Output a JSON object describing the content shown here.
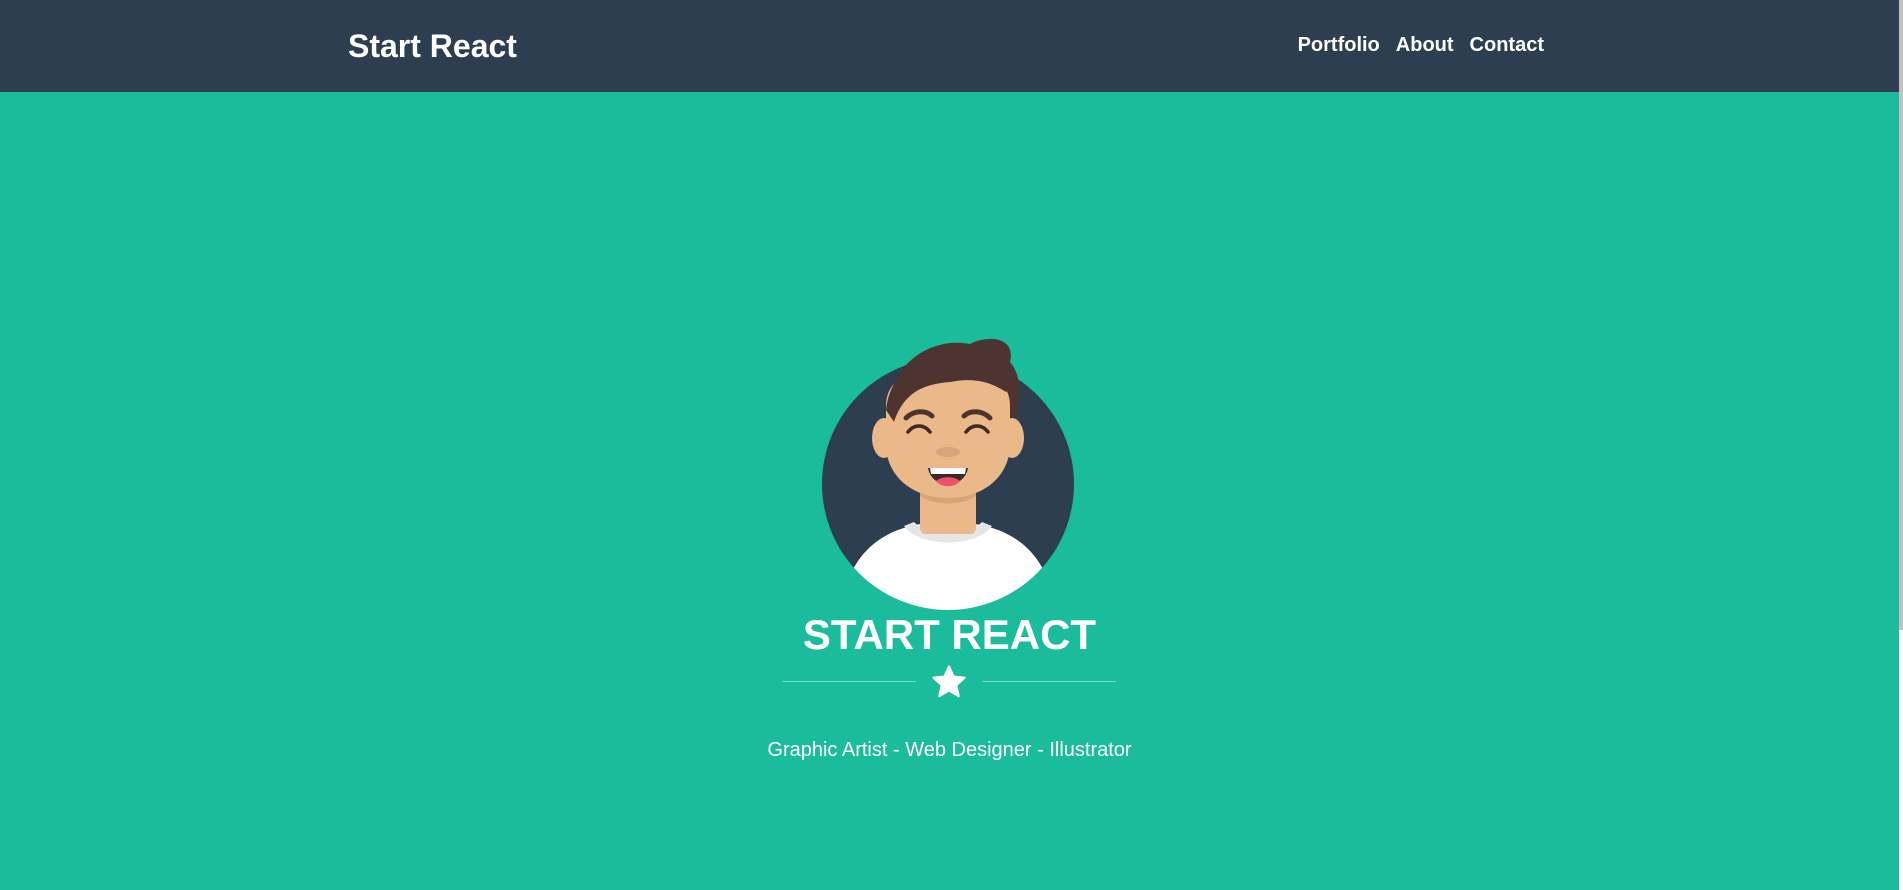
{
  "navbar": {
    "brand": "Start React",
    "links": [
      "Portfolio",
      "About",
      "Contact"
    ]
  },
  "masthead": {
    "heading": "START REACT",
    "subtitle": "Graphic Artist - Web Designer - Illustrator",
    "avatar_icon": "avatar-illustration",
    "divider_icon": "star-icon"
  },
  "colors": {
    "navbar_bg": "#2c3e50",
    "hero_bg": "#1abc9c",
    "text": "#ffffff"
  }
}
